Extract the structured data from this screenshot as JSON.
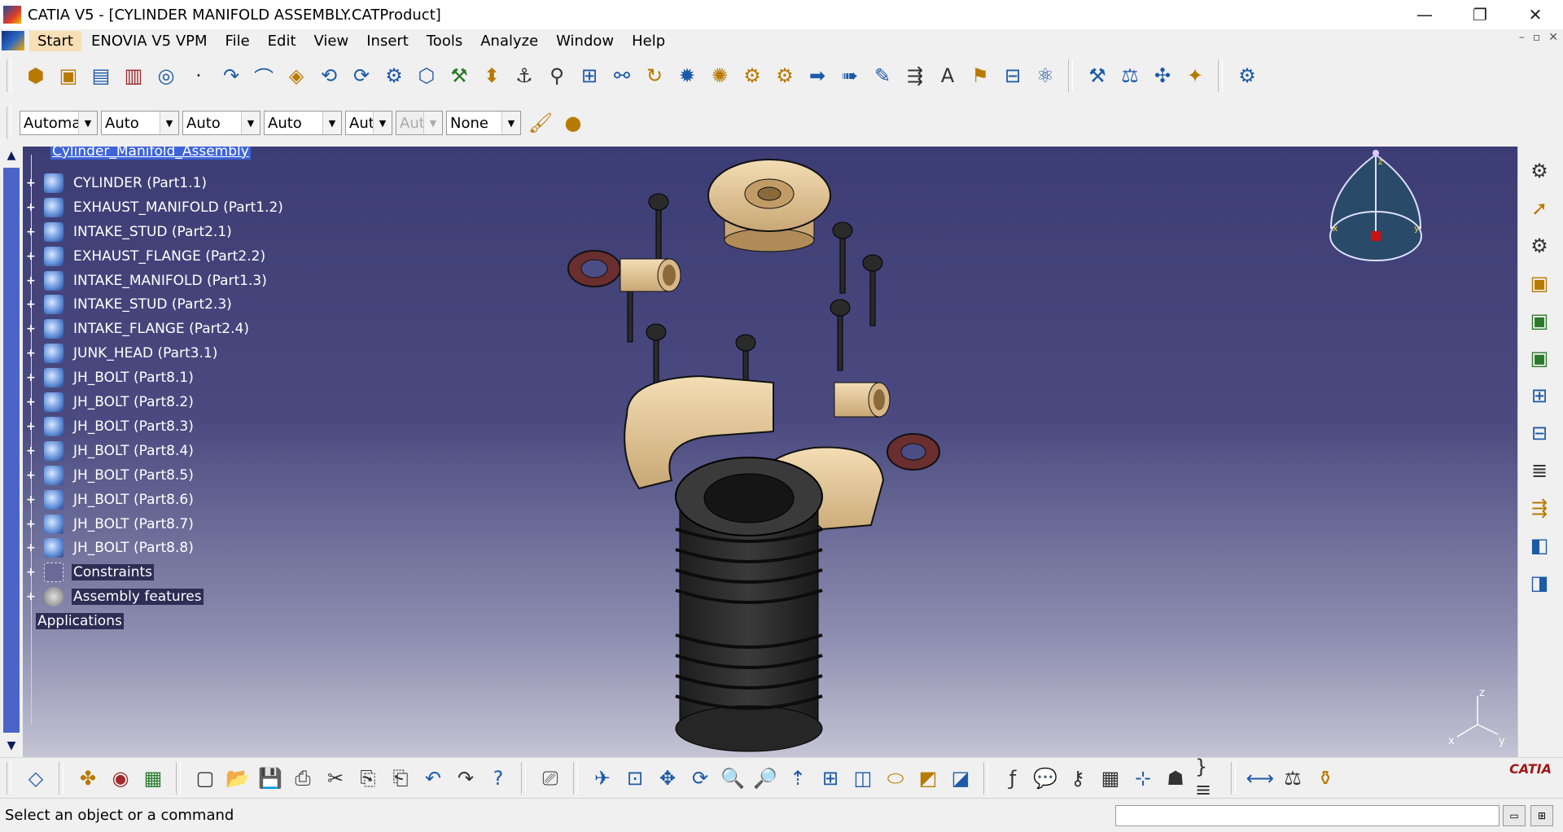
{
  "window": {
    "title": "CATIA V5 - [CYLINDER MANIFOLD ASSEMBLY.CATProduct]",
    "controls": [
      "—",
      "❐",
      "✕"
    ]
  },
  "menubar": {
    "items": [
      "Start",
      "ENOVIA V5 VPM",
      "File",
      "Edit",
      "View",
      "Insert",
      "Tools",
      "Analyze",
      "Window",
      "Help"
    ],
    "mdi_controls": [
      "–",
      "▫",
      "✕"
    ]
  },
  "graphic_props": {
    "combos": [
      {
        "value": "Automa",
        "disabled": false
      },
      {
        "value": "Auto",
        "disabled": false
      },
      {
        "value": "Auto",
        "disabled": false
      },
      {
        "value": "Auto",
        "disabled": false
      },
      {
        "value": "Aut",
        "disabled": false
      },
      {
        "value": "Aut",
        "disabled": true
      },
      {
        "value": "None",
        "disabled": false
      }
    ]
  },
  "tree": {
    "root": "Cylinder_Manifold_Assembly",
    "nodes": [
      {
        "label": "CYLINDER (Part1.1)",
        "icon": "part-icon"
      },
      {
        "label": "EXHAUST_MANIFOLD (Part1.2)",
        "icon": "part-icon"
      },
      {
        "label": "INTAKE_STUD (Part2.1)",
        "icon": "part-icon"
      },
      {
        "label": "EXHAUST_FLANGE (Part2.2)",
        "icon": "part-icon"
      },
      {
        "label": "INTAKE_MANIFOLD (Part1.3)",
        "icon": "part-icon"
      },
      {
        "label": "INTAKE_STUD (Part2.3)",
        "icon": "part-icon"
      },
      {
        "label": "INTAKE_FLANGE (Part2.4)",
        "icon": "part-icon"
      },
      {
        "label": "JUNK_HEAD (Part3.1)",
        "icon": "part-icon"
      },
      {
        "label": "JH_BOLT (Part8.1)",
        "icon": "part-icon"
      },
      {
        "label": "JH_BOLT (Part8.2)",
        "icon": "part-icon"
      },
      {
        "label": "JH_BOLT (Part8.3)",
        "icon": "part-icon"
      },
      {
        "label": "JH_BOLT (Part8.4)",
        "icon": "part-icon"
      },
      {
        "label": "JH_BOLT (Part8.5)",
        "icon": "part-icon"
      },
      {
        "label": "JH_BOLT (Part8.6)",
        "icon": "part-icon"
      },
      {
        "label": "JH_BOLT (Part8.7)",
        "icon": "part-icon"
      },
      {
        "label": "JH_BOLT (Part8.8)",
        "icon": "part-icon"
      },
      {
        "label": "Constraints",
        "icon": "constraints-icon"
      },
      {
        "label": "Assembly features",
        "icon": "assembly-features-icon"
      }
    ],
    "applications": "Applications"
  },
  "compass": {
    "z": "z",
    "x": "x",
    "y": "y"
  },
  "axis_triad": {
    "z": "z",
    "x": "x",
    "y": "y"
  },
  "status": {
    "message": "Select an object or a command"
  },
  "branding": {
    "logo_text": "CATIA"
  },
  "colors": {
    "viewport_top": "#3d3d75",
    "viewport_bottom": "#c4c4d4",
    "part_color": "#e8cda0",
    "cylinder_color": "#2e2e2e",
    "selection": "#3e64d8"
  },
  "toolbars": {
    "top_row": [
      "product-icon",
      "component-icon",
      "insert-component-icon",
      "existing-component-icon",
      "sketch-icon",
      "point-icon",
      "line-icon",
      "curve-icon",
      "plane-icon",
      "explode-icon",
      "fix-icon",
      "snap-icon",
      "manipulate-icon",
      "coincidence-icon",
      "contact-icon",
      "offset-icon",
      "angle-icon",
      "fix-together-icon",
      "smart-move-icon",
      "reuse-pattern-icon",
      "update-icon",
      "change-constraint-icon",
      "analyze-icon",
      "clash-icon",
      "sectioning-icon",
      "distance-icon",
      "bom-icon",
      "annotation-icon",
      "text-icon",
      "flag-icon",
      "catalog-icon",
      "render-icon",
      "manipulation-icon",
      "measure-icon",
      "spin-icon",
      "apply-material-icon",
      "workbench-icon"
    ],
    "bottom_row": [
      "hide-show-icon",
      "swap-icon",
      "specs-icon",
      "style-icon",
      "new-icon",
      "open-icon",
      "save-icon",
      "print-icon",
      "cut-icon",
      "copy-icon",
      "paste-icon",
      "undo-icon",
      "redo-icon",
      "whats-this-icon",
      "fly-icon",
      "fit-all-icon",
      "pan-icon",
      "rotate-icon",
      "zoom-in-icon",
      "zoom-out-icon",
      "normal-view-icon",
      "multi-view-icon",
      "iso-view-icon",
      "shading-icon",
      "hide-icon",
      "show-icon",
      "formula-icon",
      "annotation-icon",
      "lock-icon",
      "table-icon",
      "graph-icon",
      "knowledge-icon",
      "rules-icon",
      "measure-between-icon",
      "measure-item-icon",
      "inertia-icon"
    ]
  }
}
